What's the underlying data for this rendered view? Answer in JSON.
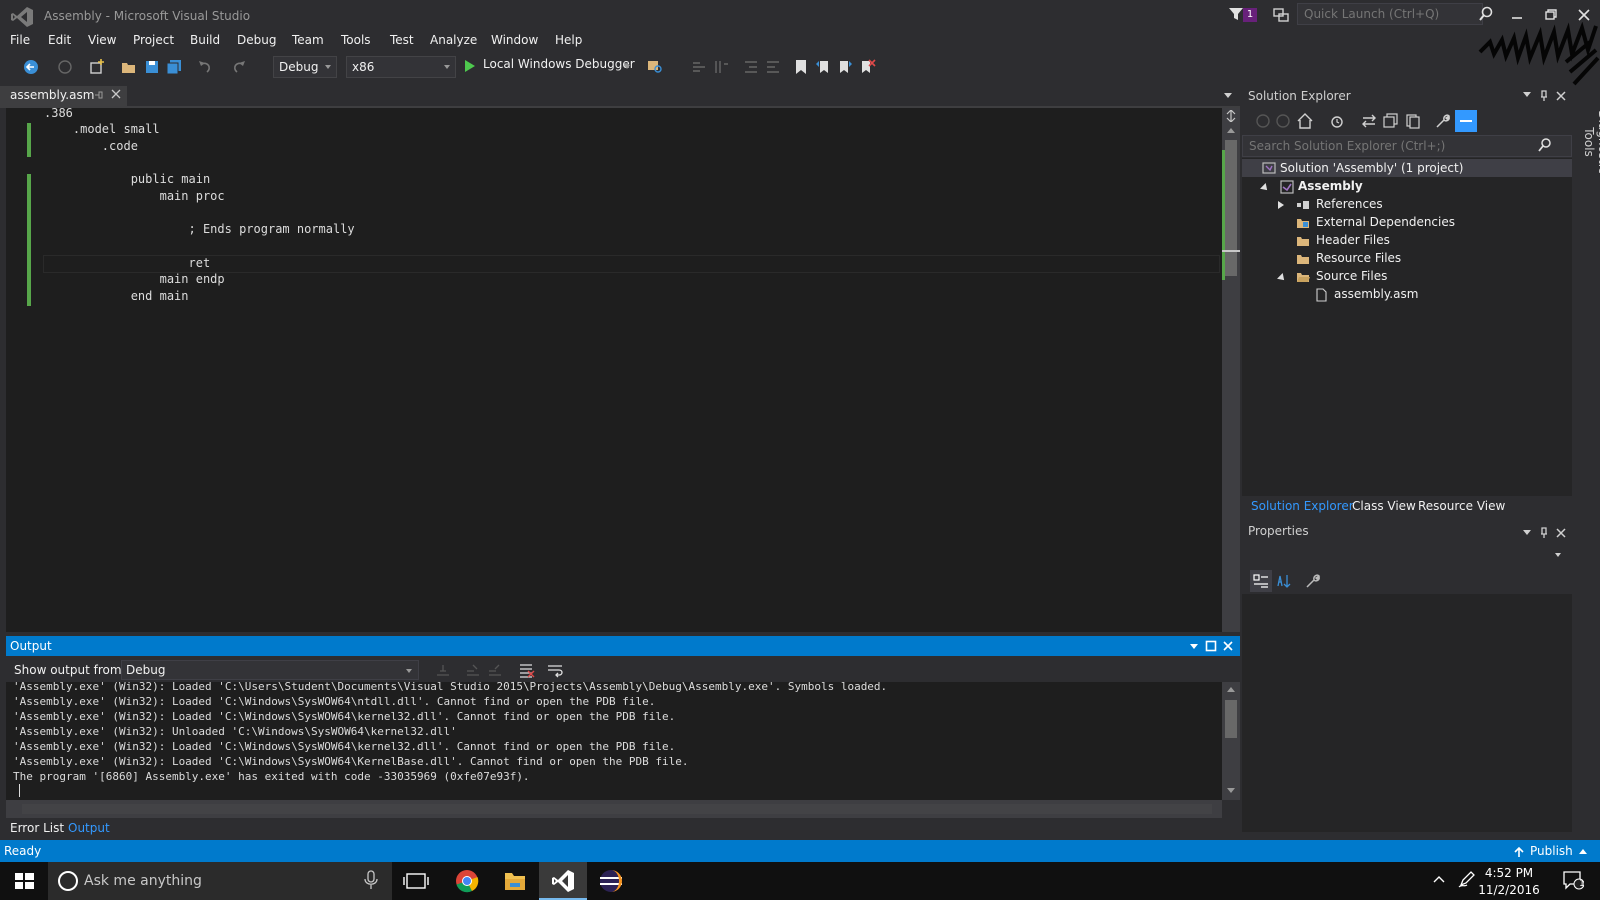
{
  "window": {
    "title": "Assembly - Microsoft Visual Studio",
    "notification_count": "1",
    "quick_launch_placeholder": "Quick Launch (Ctrl+Q)"
  },
  "menu": [
    "File",
    "Edit",
    "View",
    "Project",
    "Build",
    "Debug",
    "Team",
    "Tools",
    "Test",
    "Analyze",
    "Window",
    "Help"
  ],
  "toolbar": {
    "configuration": "Debug",
    "platform": "x86",
    "debugger": "Local Windows Debugger"
  },
  "editor": {
    "tab_label": "assembly.asm",
    "lines": [
      ".386",
      "    .model small",
      "        .code",
      "",
      "            public main",
      "                main proc",
      "",
      "                    ; Ends program normally",
      "",
      "                    ret",
      "                main endp",
      "            end main"
    ]
  },
  "solution_explorer": {
    "title": "Solution Explorer",
    "search_placeholder": "Search Solution Explorer (Ctrl+;)",
    "tree": {
      "solution": "Solution 'Assembly' (1 project)",
      "project": "Assembly",
      "references": "References",
      "external_deps": "External Dependencies",
      "header_files": "Header Files",
      "resource_files": "Resource Files",
      "source_files": "Source Files",
      "file": "assembly.asm"
    },
    "tabs": [
      "Solution Explorer",
      "Class View",
      "Resource View"
    ]
  },
  "properties": {
    "title": "Properties"
  },
  "diagnostic_tools": {
    "label": "Diagnostic Tools"
  },
  "output": {
    "title": "Output",
    "show_from_label": "Show output from:",
    "source": "Debug",
    "lines": [
      "'Assembly.exe' (Win32): Loaded 'C:\\Users\\Student\\Documents\\Visual Studio 2015\\Projects\\Assembly\\Debug\\Assembly.exe'. Symbols loaded.",
      "'Assembly.exe' (Win32): Loaded 'C:\\Windows\\SysWOW64\\ntdll.dll'. Cannot find or open the PDB file.",
      "'Assembly.exe' (Win32): Loaded 'C:\\Windows\\SysWOW64\\kernel32.dll'. Cannot find or open the PDB file.",
      "'Assembly.exe' (Win32): Unloaded 'C:\\Windows\\SysWOW64\\kernel32.dll'",
      "'Assembly.exe' (Win32): Loaded 'C:\\Windows\\SysWOW64\\kernel32.dll'. Cannot find or open the PDB file.",
      "'Assembly.exe' (Win32): Loaded 'C:\\Windows\\SysWOW64\\KernelBase.dll'. Cannot find or open the PDB file.",
      "The program '[6860] Assembly.exe' has exited with code -33035969 (0xfe07e93f)."
    ],
    "tabs": [
      "Error List",
      "Output"
    ]
  },
  "status": {
    "text": "Ready",
    "publish": "Publish"
  },
  "taskbar": {
    "search_placeholder": "Ask me anything",
    "time": "4:52 PM",
    "date": "11/2/2016",
    "notifications": "1"
  },
  "colors": {
    "accent": "#007acc",
    "background": "#2d2d30",
    "editor_bg": "#1e1e1e",
    "change_marker": "#57a64a",
    "vs_purple": "#68217a"
  }
}
